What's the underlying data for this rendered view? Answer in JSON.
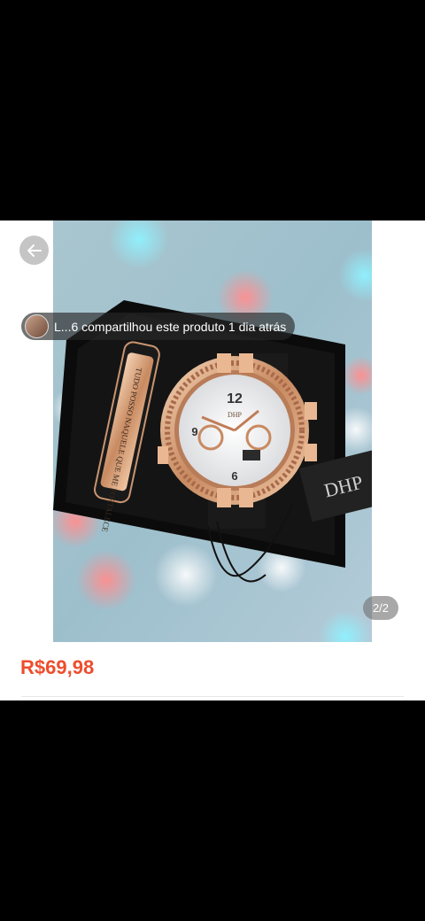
{
  "header": {
    "back_icon": "arrow-left-icon"
  },
  "gallery": {
    "share_text": "L...6 compartilhou este produto 1 dia atrás",
    "page_indicator": "2/2",
    "bracelet_engraving": "TUDO POSSO NAQUELE QUE ME FORTALECE",
    "brand_tag": "DHP",
    "dial_logo": "DHP"
  },
  "product": {
    "price": "R$69,98"
  },
  "colors": {
    "price": "#ee4d2d",
    "rose_gold": "#d9a279",
    "box": "#0d0d0d"
  }
}
